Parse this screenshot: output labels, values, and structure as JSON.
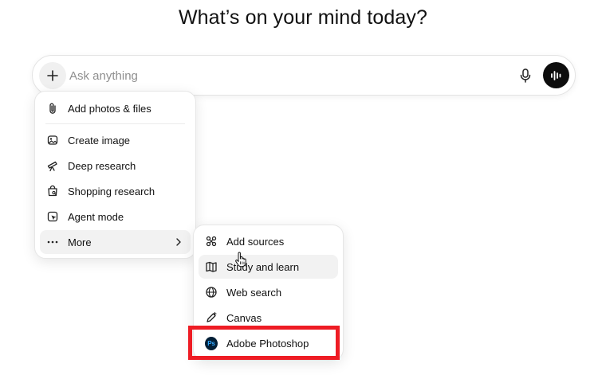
{
  "heading": "What’s on your mind today?",
  "composer": {
    "placeholder": "Ask anything",
    "value": ""
  },
  "menu": {
    "items": [
      {
        "label": "Add photos & files",
        "icon": "paperclip-icon"
      },
      {
        "label": "Create image",
        "icon": "image-icon"
      },
      {
        "label": "Deep research",
        "icon": "telescope-icon"
      },
      {
        "label": "Shopping research",
        "icon": "shopping-bag-icon"
      },
      {
        "label": "Agent mode",
        "icon": "agent-icon"
      },
      {
        "label": "More",
        "icon": "ellipsis-icon"
      }
    ]
  },
  "submenu": {
    "items": [
      {
        "label": "Add sources",
        "icon": "sources-icon"
      },
      {
        "label": "Study and learn",
        "icon": "book-icon"
      },
      {
        "label": "Web search",
        "icon": "globe-icon"
      },
      {
        "label": "Canvas",
        "icon": "pen-icon"
      },
      {
        "label": "Adobe Photoshop",
        "icon": "photoshop-icon",
        "icon_text": "Ps"
      }
    ]
  },
  "colors": {
    "highlight_box": "#ee1c24",
    "photoshop_bg": "#001e36",
    "photoshop_fg": "#31a8ff",
    "voice_button": "#0d0d0d"
  }
}
